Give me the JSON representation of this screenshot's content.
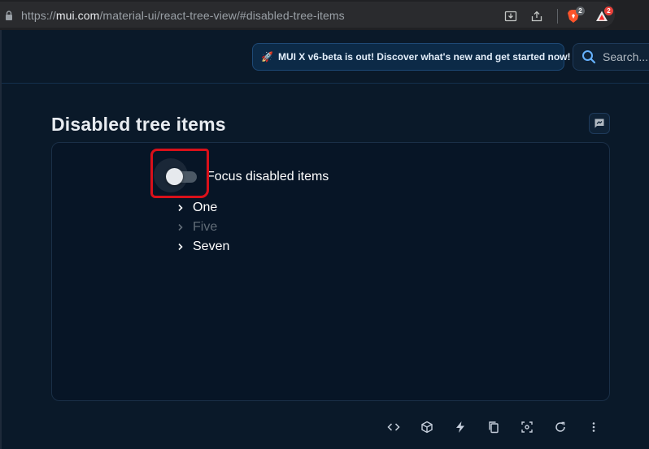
{
  "browser": {
    "url_prefix": "https://",
    "url_host": "mui.com",
    "url_path": "/material-ui/react-tree-view/#disabled-tree-items",
    "brave_badge": "2",
    "rewards_badge": "2"
  },
  "header": {
    "banner_text": "MUI X v6-beta is out! Discover what's new and get started now!",
    "search_placeholder": "Search..."
  },
  "section": {
    "title": "Disabled tree items"
  },
  "demo": {
    "switch_label": "Focus disabled items",
    "switch_checked": false,
    "tree_items": [
      {
        "label": "One",
        "disabled": false
      },
      {
        "label": "Five",
        "disabled": true
      },
      {
        "label": "Seven",
        "disabled": false
      }
    ]
  },
  "toolbar": {
    "icons": [
      "code-icon",
      "codesandbox-icon",
      "stackblitz-icon",
      "copy-icon",
      "focus-icon",
      "reset-icon",
      "more-icon"
    ]
  },
  "colors": {
    "background": "#0a1929",
    "annotation": "#d9101a",
    "banner_bg": "#0c2a47"
  }
}
